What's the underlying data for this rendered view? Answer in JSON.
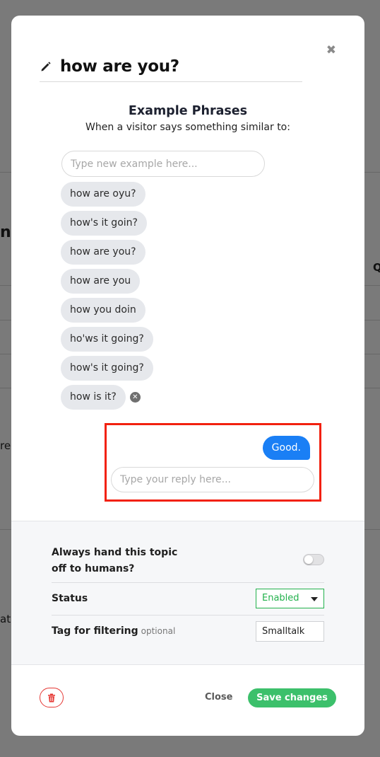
{
  "background": {
    "fragment_1": "ns",
    "fragment_2": "re",
    "fragment_3": "ati",
    "fragment_4": "Q"
  },
  "modal": {
    "title": "how are you?",
    "close_icon": "close-icon",
    "edit_icon": "pencil-icon"
  },
  "phrases": {
    "heading": "Example Phrases",
    "subheading": "When a visitor says something similar to:",
    "input_placeholder": "Type new example here...",
    "items": [
      "how are oyu?",
      "how's it goin?",
      "how are you?",
      "how are you",
      "how you doin",
      "ho'ws it going?",
      "how's it going?",
      "how is it?"
    ]
  },
  "reply": {
    "message": "Good.",
    "input_placeholder": "Type your reply here..."
  },
  "settings": {
    "handoff_label": "Always hand this topic off to humans?",
    "handoff_enabled": false,
    "status_label": "Status",
    "status_value": "Enabled",
    "tag_label": "Tag for filtering",
    "tag_optional": "optional",
    "tag_value": "Smalltalk"
  },
  "footer": {
    "delete_icon": "trash-icon",
    "close_label": "Close",
    "save_label": "Save changes"
  },
  "colors": {
    "accent_blue": "#1a7ff5",
    "save_green": "#3cc06b",
    "status_green": "#22b14c",
    "highlight_red": "#f2210f",
    "delete_red": "#e53935"
  }
}
